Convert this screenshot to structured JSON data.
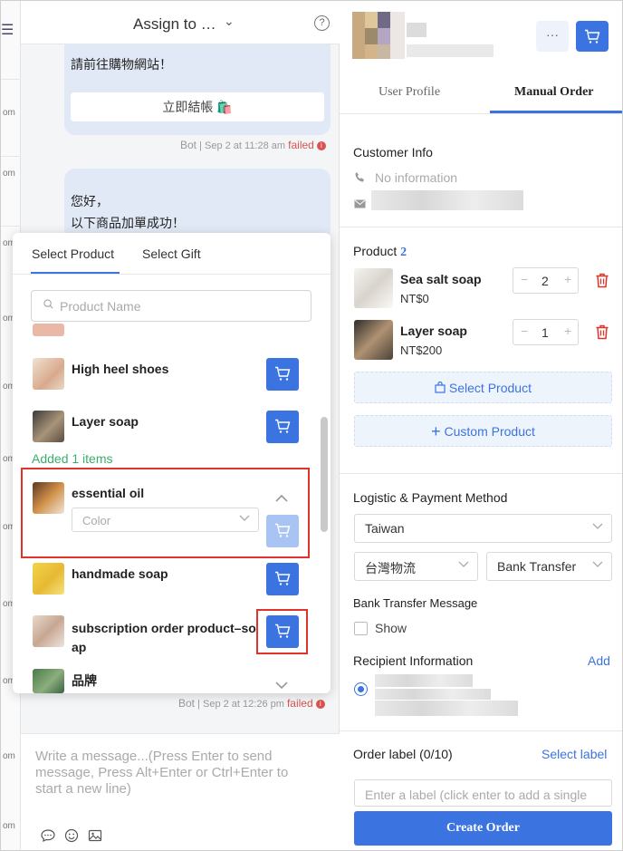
{
  "chat": {
    "header_title": "Assign to …",
    "help_symbol": "?",
    "bubble1": {
      "text": "請前往購物網站！",
      "button_label": "立即結帳 🛍️"
    },
    "meta1": {
      "sender": "Bot",
      "time": "Sep 2 at 11:28 am",
      "status": "failed"
    },
    "bubble2": {
      "line1": "您好，",
      "line2": "以下商品加單成功！"
    },
    "meta2": {
      "sender": "Bot",
      "time": "Sep 2 at 12:26 pm",
      "status": "failed"
    },
    "composer_placeholder": "Write a message...(Press Enter to send message, Press Alt+Enter or Ctrl+Enter to start a new line)"
  },
  "left_strip": {
    "item_suffix": "om"
  },
  "picker": {
    "tabs": [
      "Select Product",
      "Select Gift"
    ],
    "active_tab": 0,
    "search_placeholder": "Product Name",
    "added_text": "Added 1 items",
    "products": [
      {
        "name": "High heel shoes"
      },
      {
        "name": "Layer soap"
      },
      {
        "name": "essential oil",
        "variant_placeholder": "Color"
      },
      {
        "name": "handmade soap"
      },
      {
        "name": "subscription order product–so ap"
      },
      {
        "name": "品牌"
      }
    ]
  },
  "profile": {
    "tabs": [
      "User Profile",
      "Manual Order"
    ],
    "active_tab": 1,
    "more_symbol": "···",
    "customer_info_title": "Customer Info",
    "phone_text": "No information",
    "product_title": "Product",
    "product_count": "2",
    "order_items": [
      {
        "name": "Sea salt soap",
        "price": "NT$0",
        "qty": "2"
      },
      {
        "name": "Layer soap",
        "price": "NT$200",
        "qty": "1"
      }
    ],
    "select_product_label": "Select Product",
    "custom_product_label": "Custom Product",
    "logistic_title": "Logistic & Payment Method",
    "country": "Taiwan",
    "logistic": "台灣物流",
    "payment": "Bank Transfer",
    "bank_msg_title": "Bank Transfer Message",
    "show_label": "Show",
    "recipient_title": "Recipient Information",
    "add_label": "Add",
    "order_label_title": "Order label (0/10)",
    "select_label_link": "Select label",
    "label_placeholder": "Enter a label (click enter to add a single",
    "create_button": "Create Order"
  },
  "colors": {
    "accent": "#3b73e0",
    "danger": "#e0332a",
    "success": "#3cae6a"
  }
}
